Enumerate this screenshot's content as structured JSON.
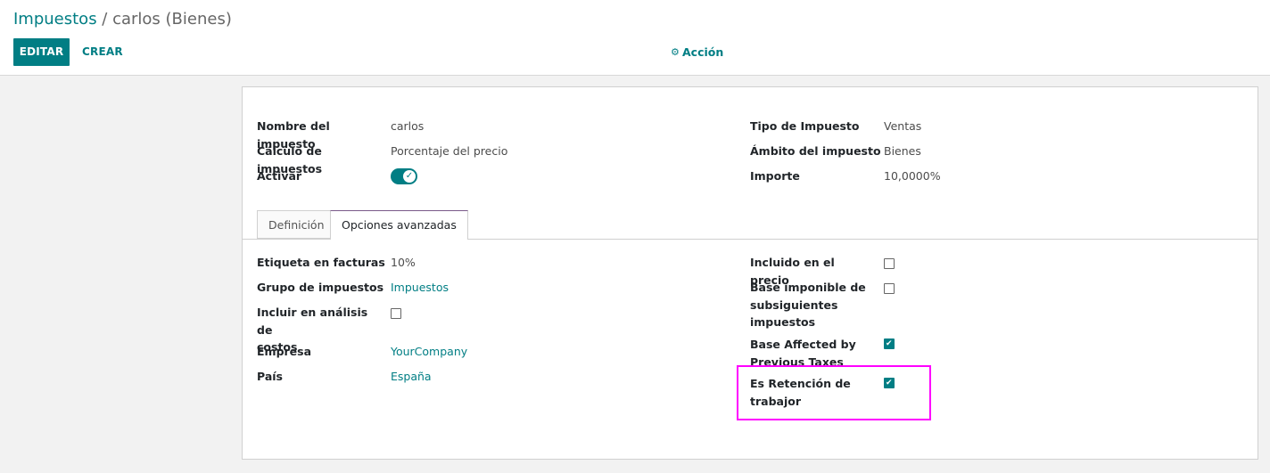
{
  "breadcrumb": {
    "parent": "Impuestos",
    "separator": " / ",
    "current": "carlos (Bienes)"
  },
  "toolbar": {
    "edit_label": "EDITAR",
    "create_label": "CREAR",
    "action_label": "Acción",
    "action_icon": "gear-icon"
  },
  "header_fields": {
    "left": [
      {
        "label": "Nombre del impuesto",
        "value": "carlos"
      },
      {
        "label": "Cálculo de impuestos",
        "value": "Porcentaje del precio"
      },
      {
        "label": "Activar",
        "value": ""
      }
    ],
    "right": [
      {
        "label": "Tipo de Impuesto",
        "value": "Ventas"
      },
      {
        "label": "Ámbito del impuesto",
        "value": "Bienes"
      },
      {
        "label": "Importe",
        "value": "10,0000%"
      }
    ]
  },
  "activar_toggle": true,
  "tabs": [
    {
      "label": "Definición",
      "active": false
    },
    {
      "label": "Opciones avanzadas",
      "active": true
    }
  ],
  "advanced": {
    "left": [
      {
        "label": "Etiqueta en facturas",
        "value": "10%"
      },
      {
        "label": "Grupo de impuestos",
        "value": "Impuestos"
      },
      {
        "label_line1": "Incluir en análisis de",
        "label_line2": "costos",
        "checked": false
      },
      {
        "label": "Empresa",
        "value": "YourCompany"
      },
      {
        "label": "País",
        "value": "España"
      }
    ],
    "right": [
      {
        "label": "Incluido en el precio",
        "checked": false
      },
      {
        "label_line1": "Base imponible de",
        "label_line2": "subsiguientes",
        "label_line3": "impuestos",
        "checked": false
      },
      {
        "label_line1": "Base Affected by",
        "label_line2": "Previous Taxes",
        "checked": true
      },
      {
        "label_line1": "Es Retención de",
        "label_line2": "trabajor",
        "checked": true
      }
    ]
  },
  "colors": {
    "brand": "#017e84",
    "highlight": "#ff00ff"
  }
}
